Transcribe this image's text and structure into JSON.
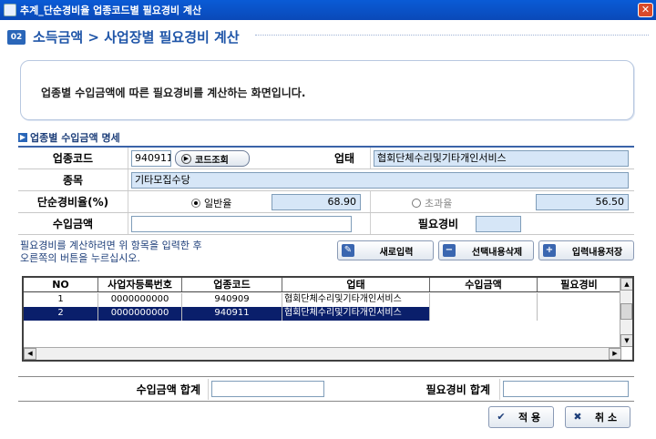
{
  "window": {
    "title": "추계_단순경비율 업종코드별 필요경비 계산",
    "close_label": "✕"
  },
  "section": {
    "number": "02",
    "title": "소득금액 > 사업장별 필요경비 계산"
  },
  "info": {
    "text": "업종별 수입금액에 따른 필요경비를 계산하는 화면입니다."
  },
  "subhead": {
    "title": "업종별 수입금액 명세"
  },
  "form": {
    "code_label": "업종코드",
    "code_value": "940911",
    "code_btn": "코드조회",
    "biz_label": "업태",
    "biz_value": "협회단체수리및기타개인서비스",
    "item_label": "종목",
    "item_value": "기타모집수당",
    "rate_label": "단순경비율(%)",
    "general_label": "일반율",
    "general_value": "68.90",
    "excess_label": "초과율",
    "excess_value": "56.50",
    "income_label": "수입금액",
    "income_value": "",
    "expense_label": "필요경비",
    "expense_value": ""
  },
  "hint": {
    "line1": "필요경비를 계산하려면 위 항목을 입력한 후",
    "line2": "오른쪽의 버튼을 누르십시오."
  },
  "actions": {
    "new": "새로입력",
    "delete": "선택내용삭제",
    "save": "입력내용저장"
  },
  "table": {
    "columns": [
      "NO",
      "사업자등록번호",
      "업종코드",
      "업태",
      "수입금액",
      "필요경비"
    ],
    "rows": [
      {
        "no": "1",
        "reg": "0000000000",
        "code": "940909",
        "biz": "협회단체수리및기타개인서비스",
        "income": "",
        "expense": ""
      },
      {
        "no": "2",
        "reg": "0000000000",
        "code": "940911",
        "biz": "협회단체수리및기타개인서비스",
        "income": "",
        "expense": ""
      }
    ],
    "selected_row": 2
  },
  "totals": {
    "income_label": "수입금액 합계",
    "expense_label": "필요경비 합계",
    "income_value": "",
    "expense_value": ""
  },
  "footer": {
    "apply": "적 용",
    "cancel": "취 소"
  }
}
